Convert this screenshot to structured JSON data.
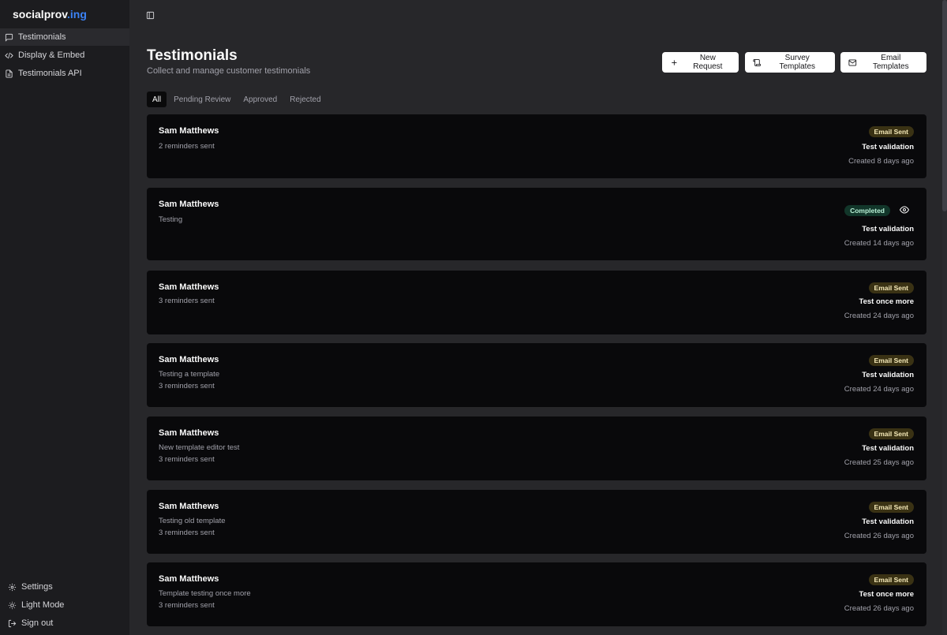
{
  "brand": {
    "text": "socialprov",
    "accent": ".ing"
  },
  "sidebar": {
    "items": [
      {
        "label": "Testimonials",
        "icon": "message-square-icon",
        "active": true
      },
      {
        "label": "Display & Embed",
        "icon": "code-icon",
        "active": false
      },
      {
        "label": "Testimonials API",
        "icon": "file-text-icon",
        "active": false
      }
    ],
    "bottom": [
      {
        "label": "Settings",
        "icon": "gear-icon"
      },
      {
        "label": "Light Mode",
        "icon": "sun-icon"
      },
      {
        "label": "Sign out",
        "icon": "logout-icon"
      }
    ]
  },
  "header": {
    "title": "Testimonials",
    "subtitle": "Collect and manage customer testimonials",
    "actions": [
      {
        "label": "New Request",
        "icon": "plus-icon"
      },
      {
        "label": "Survey Templates",
        "icon": "scroll-icon"
      },
      {
        "label": "Email Templates",
        "icon": "mail-icon"
      }
    ]
  },
  "tabs": [
    {
      "label": "All",
      "active": true
    },
    {
      "label": "Pending Review",
      "active": false
    },
    {
      "label": "Approved",
      "active": false
    },
    {
      "label": "Rejected",
      "active": false
    }
  ],
  "cards": [
    {
      "name": "Sam Matthews",
      "lines": [
        "2 reminders sent"
      ],
      "status": "Email Sent",
      "template": "Test validation",
      "created": "Created 8 days ago"
    },
    {
      "name": "Sam Matthews",
      "lines": [
        "Testing"
      ],
      "status": "Completed",
      "template": "Test validation",
      "created": "Created 14 days ago"
    },
    {
      "name": "Sam Matthews",
      "lines": [
        "3 reminders sent"
      ],
      "status": "Email Sent",
      "template": "Test once more",
      "created": "Created 24 days ago"
    },
    {
      "name": "Sam Matthews",
      "lines": [
        "Testing a template",
        "3 reminders sent"
      ],
      "status": "Email Sent",
      "template": "Test validation",
      "created": "Created 24 days ago"
    },
    {
      "name": "Sam Matthews",
      "lines": [
        "New template editor test",
        "3 reminders sent"
      ],
      "status": "Email Sent",
      "template": "Test validation",
      "created": "Created 25 days ago"
    },
    {
      "name": "Sam Matthews",
      "lines": [
        "Testing old template",
        "3 reminders sent"
      ],
      "status": "Email Sent",
      "template": "Test validation",
      "created": "Created 26 days ago"
    },
    {
      "name": "Sam Matthews",
      "lines": [
        "Template testing once more",
        "3 reminders sent"
      ],
      "status": "Email Sent",
      "template": "Test once more",
      "created": "Created 26 days ago"
    }
  ],
  "colors": {
    "accent": "#3b82f6",
    "email_sent_badge": "#3a3214",
    "completed_badge": "#12362a",
    "card_bg": "#09090b",
    "page_bg": "#27272a",
    "sidebar_bg": "#1c1c1f"
  }
}
